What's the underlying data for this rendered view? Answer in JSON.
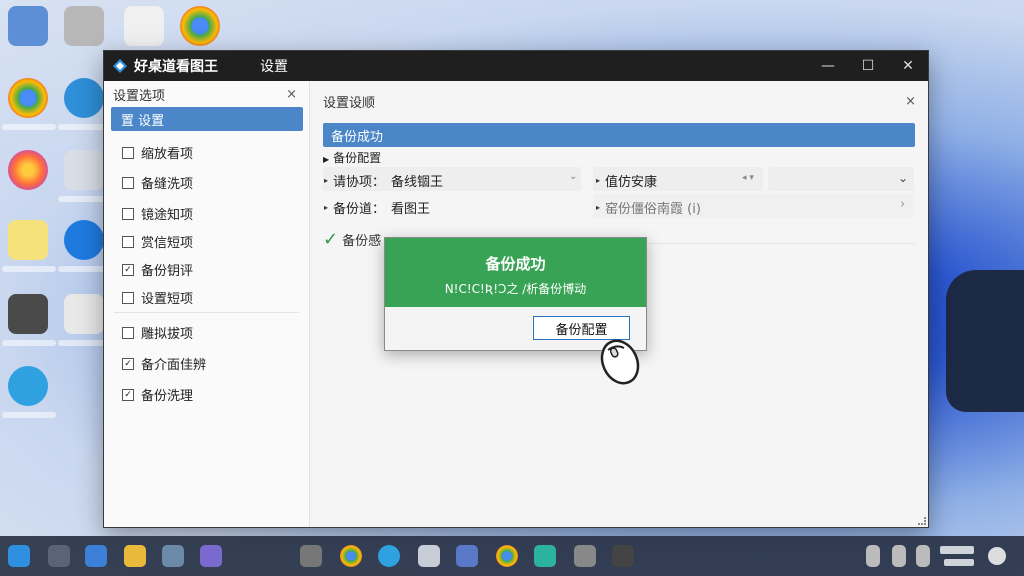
{
  "window": {
    "app_title": "好桌道看图王",
    "subtitle": "设置",
    "controls": {
      "minimize": "—",
      "maximize": "☐",
      "close": "✕"
    }
  },
  "left_panel": {
    "header": "设置选项",
    "close": "×",
    "selected_item": "置 设置",
    "items": [
      {
        "label": "缩放看项",
        "checked": false
      },
      {
        "label": "备缝洗项",
        "checked": false
      },
      {
        "label": "镜途知项",
        "checked": false
      },
      {
        "label": "赏信短项",
        "checked": false
      },
      {
        "label": "备份钥评",
        "checked": true
      },
      {
        "label": "设置短项",
        "checked": false
      },
      {
        "label": "雕拟拔项",
        "checked": false
      },
      {
        "label": "备介面佳辨",
        "checked": true
      },
      {
        "label": "备份洗理",
        "checked": true
      }
    ]
  },
  "right_panel": {
    "header": "设置设顺",
    "close": "×",
    "banner": "备份成功",
    "section_title": "备份配置",
    "fields": {
      "f1_label": "请协项：",
      "f1_value": "备线锢王",
      "f1_arrow": "⌄",
      "f2_label": "值仿安康",
      "f2_arrows": "◂ ▾",
      "f2_dropdown": "⌄",
      "f3_label": "备份道：",
      "f3_value": "看图王",
      "f4_label": "窑份僵俗南霞 (i)",
      "f4_arrow": "›"
    },
    "status": "备份感"
  },
  "dialog": {
    "title": "备份成功",
    "message": "N!C!C!Ʀ!Ɔ之 /析备份博动",
    "button": "备份配置"
  },
  "colors": {
    "accent": "#4a86c8",
    "success": "#38a354",
    "titlebar": "#1f1f1f"
  }
}
